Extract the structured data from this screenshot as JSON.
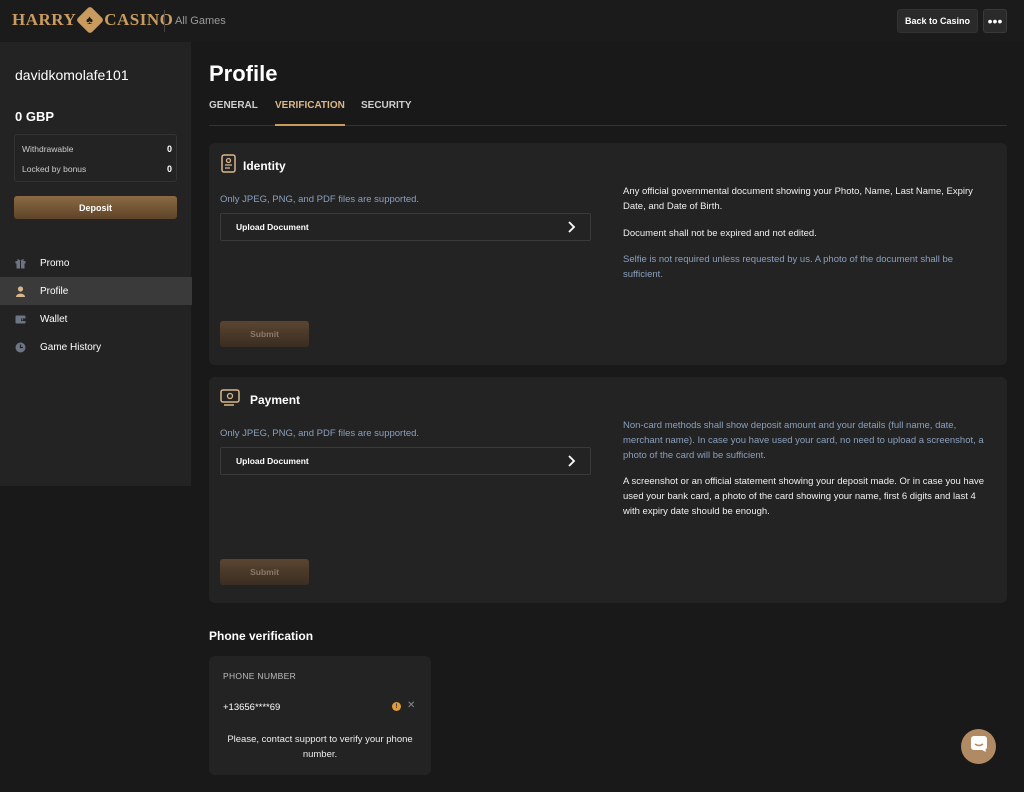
{
  "header": {
    "logo_left": "HARRY",
    "logo_right": "CASINO",
    "nav_link": "All Games",
    "back_button": "Back to Casino",
    "more_button": "•••"
  },
  "sidebar": {
    "username": "davidkomolafe101",
    "balance": "0 GBP",
    "withdrawable_label": "Withdrawable",
    "withdrawable_value": "0",
    "locked_label": "Locked by bonus",
    "locked_value": "0",
    "deposit_button": "Deposit",
    "nav": [
      {
        "label": "Promo",
        "icon": "gift-icon"
      },
      {
        "label": "Profile",
        "icon": "user-icon",
        "active": true
      },
      {
        "label": "Wallet",
        "icon": "wallet-icon"
      },
      {
        "label": "Game History",
        "icon": "clock-icon"
      }
    ]
  },
  "main": {
    "title": "Profile",
    "tabs": [
      {
        "label": "GENERAL"
      },
      {
        "label": "VERIFICATION",
        "active": true
      },
      {
        "label": "SECURITY"
      }
    ],
    "identity": {
      "title": "Identity",
      "supported": "Only JPEG, PNG, and PDF files are supported.",
      "upload": "Upload Document",
      "submit": "Submit",
      "info1": "Any official governmental document showing your Photo, Name, Last Name, Expiry Date, and Date of Birth.",
      "info2": "Document shall not be expired and not edited.",
      "info3": "Selfie is not required unless requested by us. A photo of the document shall be sufficient."
    },
    "payment": {
      "title": "Payment",
      "supported": "Only JPEG, PNG, and PDF files are supported.",
      "upload": "Upload Document",
      "submit": "Submit",
      "info1": "Non-card methods shall show deposit amount and your details (full name, date, merchant name). In case you have used your card, no need to upload a screenshot, a photo of the card will be sufficient.",
      "info2": "A screenshot or an official statement showing your deposit made. Or in case you have used your bank card, a photo of the card showing your name, first 6 digits and last 4 with expiry date should be enough."
    },
    "phone": {
      "section_title": "Phone verification",
      "label": "PHONE NUMBER",
      "number": "+13656****69",
      "message": "Please, contact support to verify your phone number."
    }
  },
  "colors": {
    "accent": "#c99b5f",
    "background": "#191919",
    "card": "#232323",
    "muted_text": "#8aa0bd",
    "pending": "#e09a3e"
  }
}
